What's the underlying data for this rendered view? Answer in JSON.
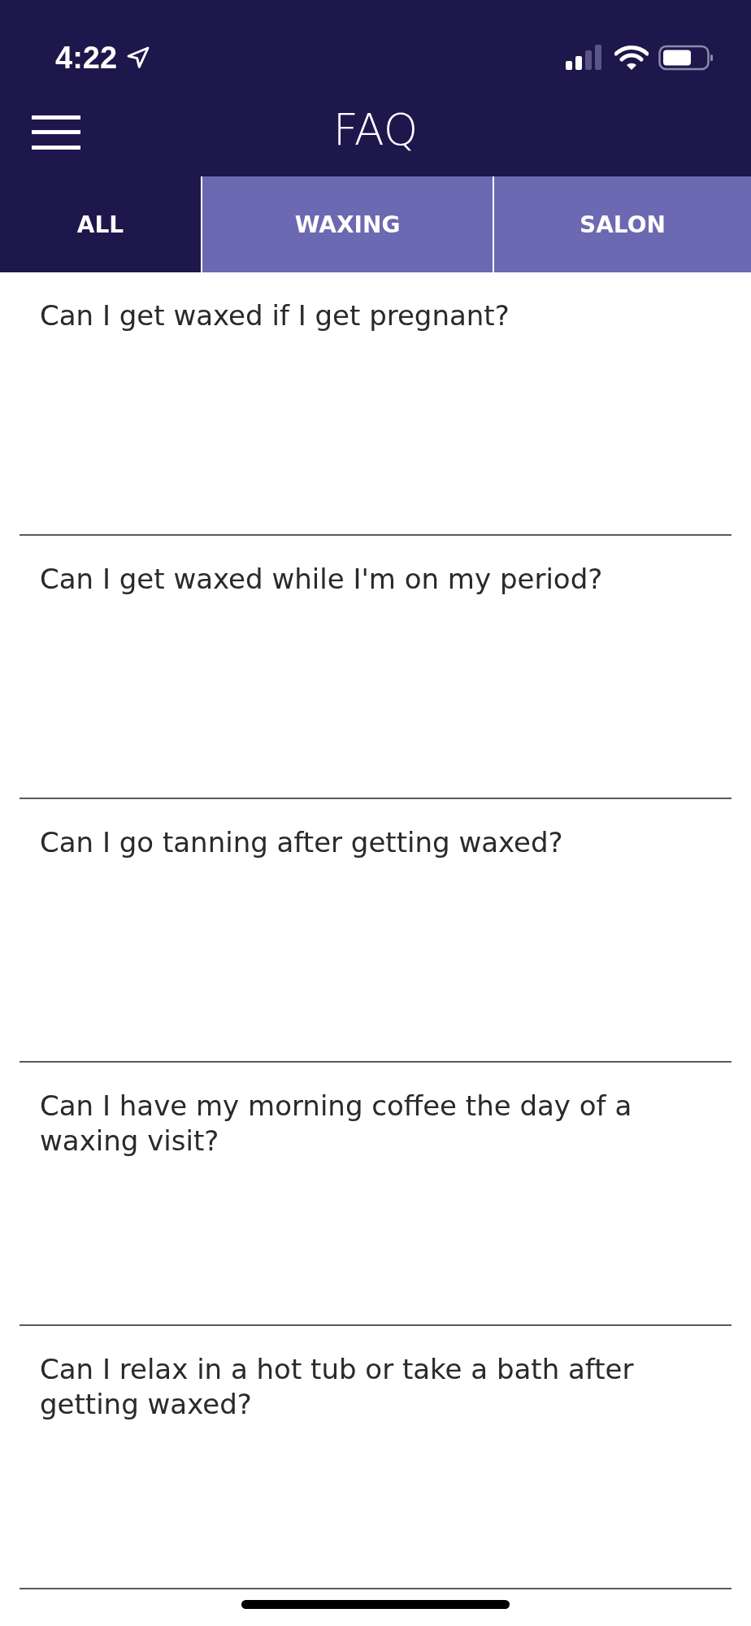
{
  "status_bar": {
    "time": "4:22"
  },
  "header": {
    "title": "FAQ"
  },
  "tabs": [
    {
      "label": "ALL",
      "selected": true
    },
    {
      "label": "WAXING",
      "selected": false
    },
    {
      "label": "SALON",
      "selected": false
    }
  ],
  "questions": [
    "Can I get waxed if I get pregnant?",
    "Can I get waxed while I'm on my period?",
    "Can I go tanning after getting waxed?",
    "Can I have my morning coffee the day of a waxing visit?",
    "Can I relax in a hot tub or take a bath after getting waxed?"
  ]
}
